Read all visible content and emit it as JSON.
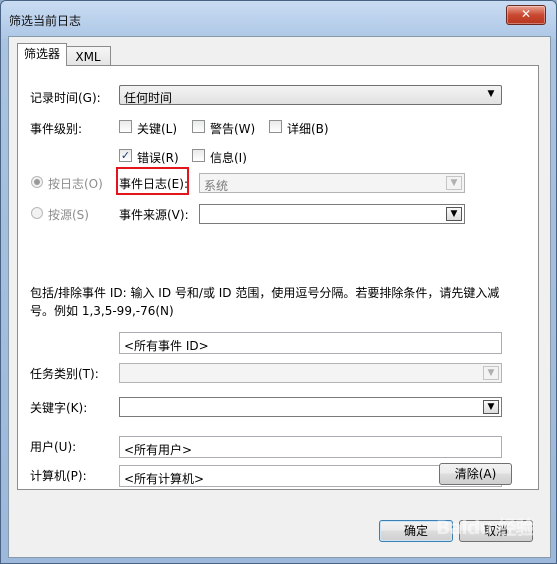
{
  "window": {
    "title": "筛选当前日志",
    "close_glyph": "✕"
  },
  "tabs": [
    {
      "label": "筛选器",
      "active": true
    },
    {
      "label": "XML",
      "active": false
    }
  ],
  "filter": {
    "logged_label": "记录时间(G):",
    "logged_value": "任何时间",
    "event_level_label": "事件级别:",
    "levels": [
      {
        "label": "关键(L)",
        "checked": false
      },
      {
        "label": "警告(W)",
        "checked": false
      },
      {
        "label": "详细(B)",
        "checked": false
      },
      {
        "label": "错误(R)",
        "checked": true
      },
      {
        "label": "信息(I)",
        "checked": false
      }
    ],
    "by_log_label": "按日志(O)",
    "event_logs_label": "事件日志(E):",
    "event_logs_value": "系统",
    "by_source_label": "按源(S)",
    "event_sources_label": "事件来源(V):",
    "description": "包括/排除事件 ID: 输入 ID 号和/或 ID 范围，使用逗号分隔。若要排除条件，请先键入减号。例如 1,3,5-99,-76(N)",
    "event_ids_value": "<所有事件 ID>",
    "task_category_label": "任务类别(T):",
    "keywords_label": "关键字(K):",
    "user_label": "用户(U):",
    "user_value": "<所有用户>",
    "computer_label": "计算机(P):",
    "computer_value": "<所有计算机>",
    "clear_button": "清除(A)"
  },
  "footer": {
    "ok_button": "确定",
    "cancel_button": "取消"
  },
  "watermark": "Baidu 经验",
  "colors": {
    "highlight": "#e3151b",
    "title_gradient_top": "#c9dcf2",
    "close_button": "#c9482f"
  }
}
